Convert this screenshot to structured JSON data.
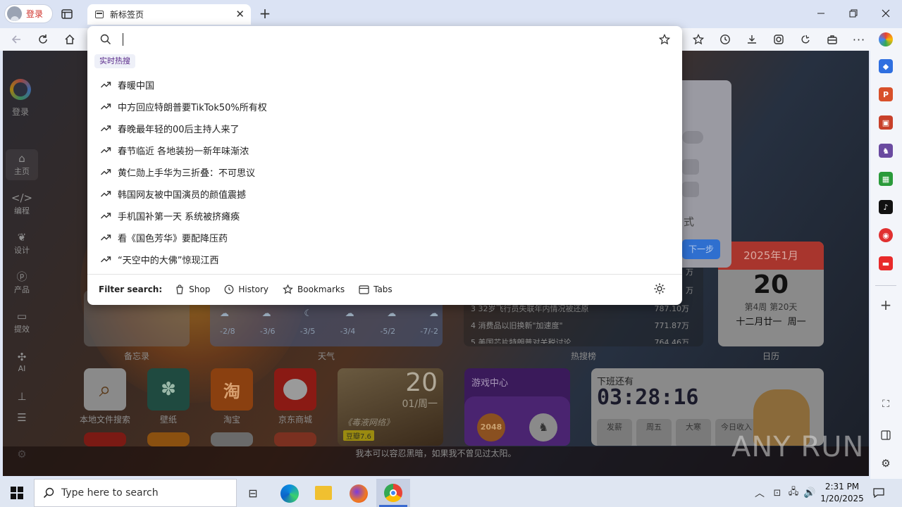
{
  "browser": {
    "login_label": "登录",
    "tab_title": "新标签页",
    "tab_close": "✕",
    "new_tab": "+"
  },
  "omnibox": {
    "hot_tag": "实时热搜",
    "suggestions": [
      "春暖中国",
      "中方回应特朗普要TikTok50%所有权",
      "春晚最年轻的00后主持人来了",
      "春节临近 各地装扮一新年味渐浓",
      "黄仁勋上手华为三折叠：不可思议",
      "韩国网友被中国演员的颜值震撼",
      "手机国补第一天 系统被挤瘫痪",
      "看《国色芳华》要配降压药",
      "“天空中的大佛”惊现江西"
    ],
    "filter_label": "Filter search:",
    "filters": [
      "Shop",
      "History",
      "Bookmarks",
      "Tabs"
    ]
  },
  "leftnav": {
    "login": "登录",
    "items": [
      "主页",
      "编程",
      "设计",
      "产品",
      "提效",
      "AI",
      "",
      ""
    ]
  },
  "newtab": {
    "card_labels": [
      "备忘录",
      "天气",
      "热搜榜",
      "日历"
    ],
    "weather_temps": [
      "-2/8",
      "-3/6",
      "-3/5",
      "-3/4",
      "-5/2",
      "-7/-2"
    ],
    "hot_rows": [
      {
        "rank": "3",
        "title": "32岁飞行员失联年内情况被还原",
        "value": "787.10万"
      },
      {
        "rank": "4",
        "title": "消费品以旧换新\"加速度\"",
        "value": "771.87万"
      },
      {
        "rank": "5",
        "title": "美国芯片特朗普对关税讨论",
        "value": "764.46万"
      }
    ],
    "hot_side_values": [
      "万",
      "万"
    ],
    "calendar": {
      "month": "2025年1月",
      "day": "20",
      "week": "第4周 第20天",
      "lunar": "十二月廿一",
      "weekday": "周一"
    },
    "apps": [
      "本地文件搜索",
      "壁纸",
      "淘宝",
      "京东商城"
    ],
    "movie": {
      "day": "20",
      "date": "01/周一",
      "title": "《毒液网络》",
      "rating": "豆瓣7.6"
    },
    "game_center": "游戏中心",
    "game_2048": "2048",
    "countdown": {
      "label": "下班还有",
      "time": "03:28:16",
      "cols": [
        "发薪",
        "周五",
        "大寒",
        "今日收入"
      ]
    },
    "quote": "我本可以容忍黑暗，如果我不曾见过太阳。",
    "onboard": {
      "partial_text": "式",
      "next_button": "下一步"
    },
    "watermark": "ANY RUN"
  },
  "taskbar": {
    "search_placeholder": "Type here to search",
    "time": "2:31 PM",
    "date": "1/20/2025"
  }
}
